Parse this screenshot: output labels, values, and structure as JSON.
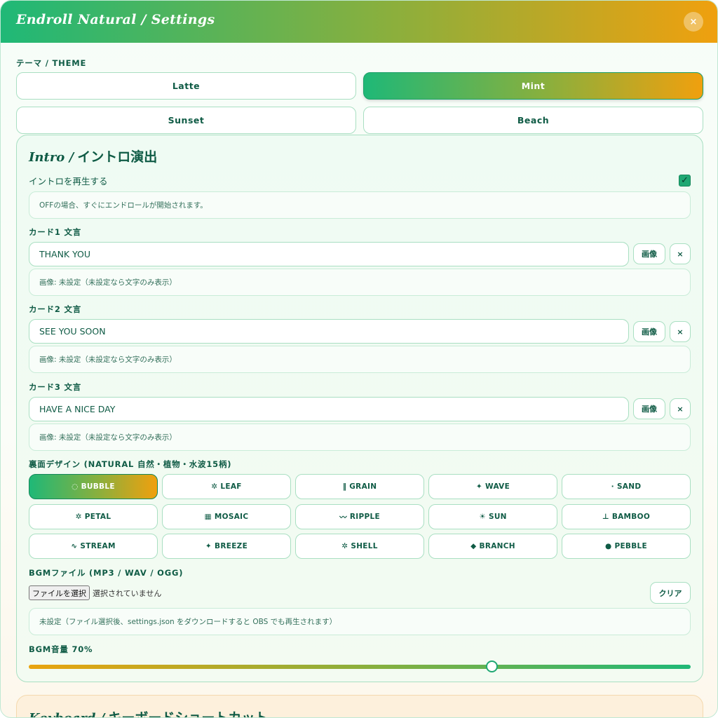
{
  "window": {
    "title": "Endroll Natural / Settings",
    "close_label": "×"
  },
  "theme": {
    "label": "テーマ / THEME",
    "options": [
      "Latte",
      "Mint",
      "Sunset",
      "Beach"
    ],
    "selected": "Mint"
  },
  "intro": {
    "title_en": "Intro /",
    "title_jp": "イントロ演出",
    "play_label": "イントロを再生する",
    "play_checked": true,
    "check_glyph": "✓",
    "play_hint": "OFFの場合、すぐにエンドロールが開始されます。",
    "cards": [
      {
        "label": "カード1 文言",
        "value": "THANK YOU",
        "image_btn": "画像",
        "clear_btn": "×",
        "hint": "画像: 未設定（未設定なら文字のみ表示）"
      },
      {
        "label": "カード2 文言",
        "value": "SEE YOU SOON",
        "image_btn": "画像",
        "clear_btn": "×",
        "hint": "画像: 未設定（未設定なら文字のみ表示）"
      },
      {
        "label": "カード3 文言",
        "value": "HAVE A NICE DAY",
        "image_btn": "画像",
        "clear_btn": "×",
        "hint": "画像: 未設定（未設定なら文字のみ表示）"
      }
    ],
    "back_design": {
      "label": "裏面デザイン (NATURAL 自然・植物・水波15柄)",
      "selected": "BUBBLE",
      "options": [
        {
          "icon": "◌",
          "label": "BUBBLE"
        },
        {
          "icon": "✲",
          "label": "LEAF"
        },
        {
          "icon": "‖",
          "label": "GRAIN"
        },
        {
          "icon": "✦",
          "label": "WAVE"
        },
        {
          "icon": "·",
          "label": "SAND"
        },
        {
          "icon": "✲",
          "label": "PETAL"
        },
        {
          "icon": "▦",
          "label": "MOSAIC"
        },
        {
          "icon": "〰",
          "label": "RIPPLE"
        },
        {
          "icon": "☀",
          "label": "SUN"
        },
        {
          "icon": "⊥",
          "label": "BAMBOO"
        },
        {
          "icon": "∿",
          "label": "STREAM"
        },
        {
          "icon": "✦",
          "label": "BREEZE"
        },
        {
          "icon": "✲",
          "label": "SHELL"
        },
        {
          "icon": "◆",
          "label": "BRANCH"
        },
        {
          "icon": "●",
          "label": "PEBBLE"
        }
      ]
    },
    "bgm": {
      "label": "BGMファイル (MP3 / WAV / OGG)",
      "choose_btn": "ファイルを選択",
      "file_status": "選択されていません",
      "clear_btn": "クリア",
      "hint": "未設定（ファイル選択後、settings.json をダウンロードすると OBS でも再生されます）",
      "volume_label": "BGM音量 70%",
      "volume_percent": 70
    }
  },
  "keyboard": {
    "title_en": "Keyboard /",
    "title_jp": "キーボードショートカット"
  }
}
